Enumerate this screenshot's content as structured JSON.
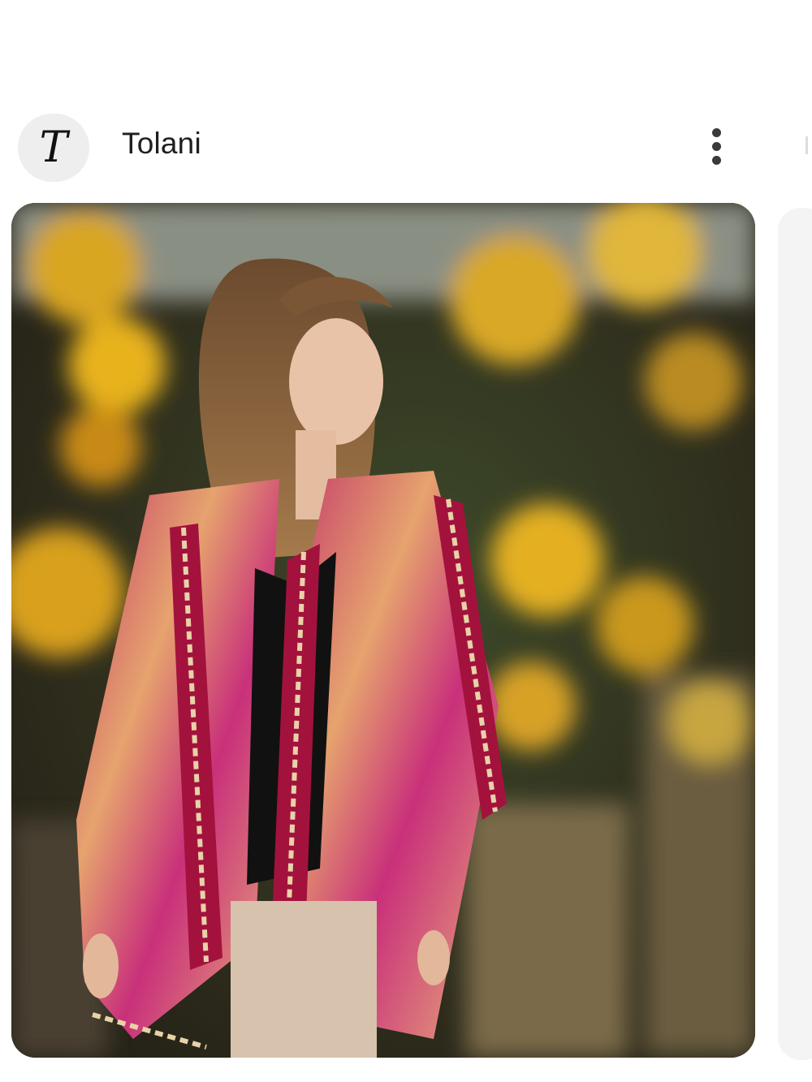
{
  "post": {
    "avatar_letter": "T",
    "brand_name": "Tolani"
  },
  "icons": {
    "more": "more-vertical-icon"
  }
}
